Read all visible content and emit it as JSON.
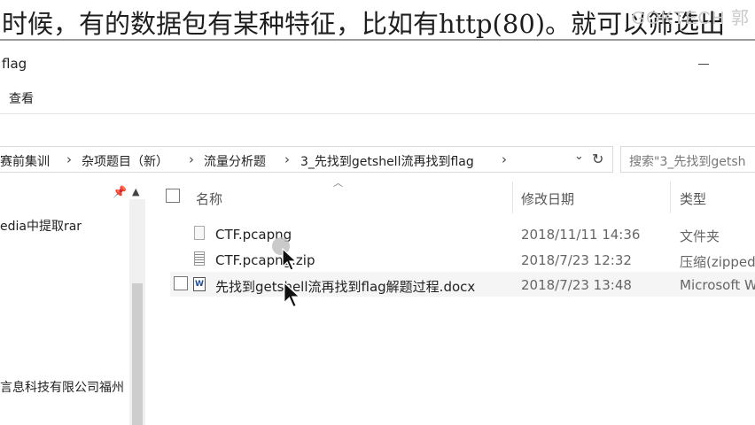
{
  "caption": {
    "text": "时候，有的数据包有某种特征，比如有http(80)。就可以筛选出",
    "watermark": "GOKTECH 郭"
  },
  "window": {
    "title": "flag"
  },
  "ribbon": {
    "tab_view": "查看"
  },
  "address": {
    "crumbs": [
      "赛前集训",
      "杂项题目（新）",
      "流量分析题",
      "3_先找到getshell流再找到flag"
    ],
    "separator": "›",
    "search_placeholder": "搜索\"3_先找到getsh"
  },
  "nav": {
    "items": [
      "edia中提取rar",
      "言息科技有限公司福州"
    ]
  },
  "columns": {
    "name": "名称",
    "date": "修改日期",
    "type": "类型"
  },
  "files": [
    {
      "name": "CTF.pcapng",
      "date": "2018/11/11 14:36",
      "type": "文件夹",
      "icon": "folder-file-icon"
    },
    {
      "name": "CTF.pcapng.zip",
      "date": "2018/7/23 12:32",
      "type": "压缩(zipped",
      "icon": "zip-file-icon"
    },
    {
      "name": "先找到getshell流再找到flag解题过程.docx",
      "date": "2018/7/23 13:48",
      "type": "Microsoft W",
      "icon": "word-doc-icon"
    }
  ]
}
